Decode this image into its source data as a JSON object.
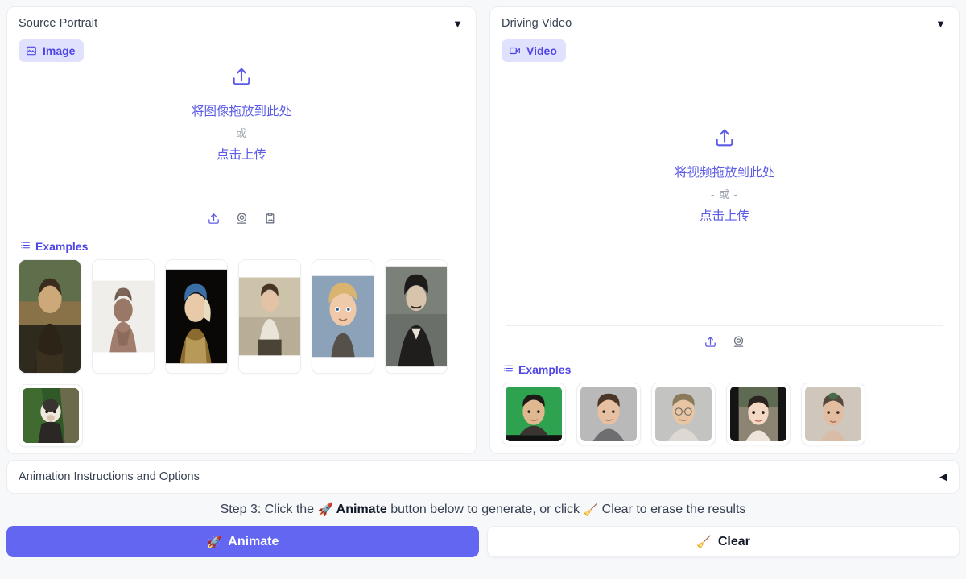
{
  "panels": [
    {
      "title": "Source Portrait",
      "caret": "▼",
      "tab": {
        "label": "Image",
        "icon": "image-icon"
      },
      "dropzone": {
        "icon": "upload-icon",
        "drop_text": "将图像拖放到此处",
        "or_text": "- 或 -",
        "click_text": "点击上传"
      },
      "tool_icons": [
        "upload-icon",
        "webcam-icon",
        "paste-image-icon"
      ],
      "examples_label": "Examples",
      "examples": [
        {
          "name": "mona-lisa"
        },
        {
          "name": "terracotta-warrior"
        },
        {
          "name": "girl-with-pearl-earring"
        },
        {
          "name": "child-portrait-painting"
        },
        {
          "name": "cartoon-boy-3d"
        },
        {
          "name": "einstein-portrait"
        },
        {
          "name": "capuchin-monkey"
        }
      ]
    },
    {
      "title": "Driving Video",
      "caret": "▼",
      "tab": {
        "label": "Video",
        "icon": "video-camera-icon"
      },
      "dropzone": {
        "icon": "upload-icon",
        "drop_text": "将视频拖放到此处",
        "or_text": "- 或 -",
        "click_text": "点击上传"
      },
      "tool_icons": [
        "upload-icon",
        "webcam-icon"
      ],
      "examples_label": "Examples",
      "examples": [
        {
          "name": "man-green-screen"
        },
        {
          "name": "man-gray-background"
        },
        {
          "name": "man-glasses-gray"
        },
        {
          "name": "woman-indoor"
        },
        {
          "name": "woman-neutral"
        }
      ]
    }
  ],
  "accordion": {
    "title": "Animation Instructions and Options",
    "caret": "◀"
  },
  "step": {
    "prefix": "Step 3: Click the",
    "animate_emoji": "🚀",
    "animate_word": "Animate",
    "middle": "button below to generate, or click",
    "clear_emoji": "🧹",
    "suffix": "Clear to erase the results"
  },
  "buttons": {
    "animate": {
      "label": "Animate",
      "emoji": "🚀",
      "color": "#6366f1"
    },
    "clear": {
      "label": "Clear",
      "emoji": "🧹",
      "color": "#ffffff"
    }
  },
  "colors": {
    "accent": "#6366f1",
    "accent_text": "#4f46e5",
    "pill_bg": "#e0e2fd",
    "page_bg": "#f7f8fa"
  }
}
